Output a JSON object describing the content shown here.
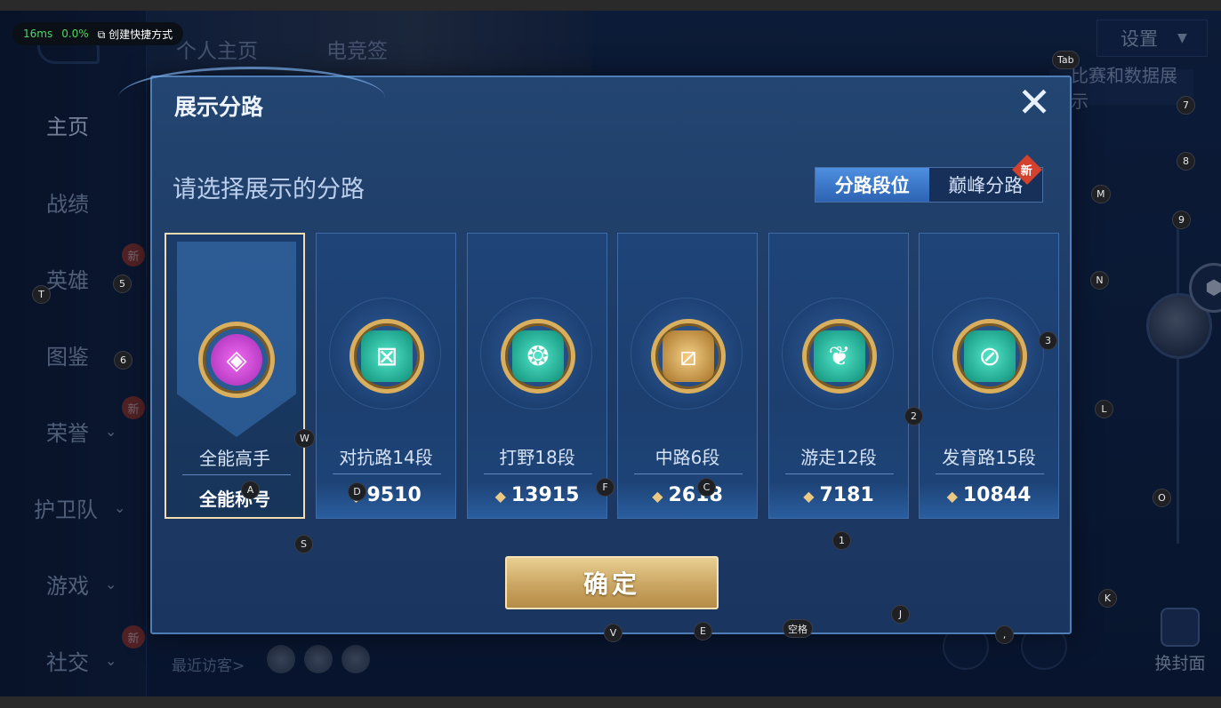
{
  "perf": {
    "latency": "16ms",
    "loss": "0.0%",
    "shortcut_label": "创建快捷方式"
  },
  "top": {
    "tab_profile": "个人主页",
    "tab_esports": "电竞签",
    "settings_label": "设置",
    "display_btn": "比赛和数据展示"
  },
  "sidebar": {
    "items": [
      {
        "label": "主页"
      },
      {
        "label": "战绩"
      },
      {
        "label": "英雄"
      },
      {
        "label": "图鉴"
      },
      {
        "label": "荣誉"
      },
      {
        "label": "护卫队"
      },
      {
        "label": "游戏"
      },
      {
        "label": "社交"
      }
    ],
    "new_label": "新"
  },
  "bottom": {
    "visitors_label": "最近访客>",
    "cover_label": "换封面"
  },
  "dialog": {
    "title": "展示分路",
    "subtitle": "请选择展示的分路",
    "segment": {
      "left": "分路段位",
      "right": "巅峰分路",
      "new_badge": "新"
    },
    "cards": [
      {
        "name": "全能高手",
        "score": "全能称号",
        "style": "purple",
        "glyph": "◈",
        "selected": true
      },
      {
        "name": "对抗路14段",
        "score": "9510",
        "style": "teal",
        "glyph": "⊠",
        "selected": false
      },
      {
        "name": "打野18段",
        "score": "13915",
        "style": "teal",
        "glyph": "❂",
        "selected": false
      },
      {
        "name": "中路6段",
        "score": "2618",
        "style": "gold",
        "glyph": "⧄",
        "selected": false
      },
      {
        "name": "游走12段",
        "score": "7181",
        "style": "teal",
        "glyph": "❦",
        "selected": false
      },
      {
        "name": "发育路15段",
        "score": "10844",
        "style": "teal",
        "glyph": "⊘",
        "selected": false
      }
    ],
    "confirm_label": "确定"
  },
  "key_hints": [
    "Tab",
    "7",
    "8",
    "M",
    "9",
    "N",
    "3",
    "5",
    "T",
    "6",
    "2",
    "L",
    "W",
    "A",
    "D",
    "F",
    "C",
    "O",
    "S",
    "1",
    "J",
    "K",
    "V",
    "E",
    "空格",
    ","
  ]
}
